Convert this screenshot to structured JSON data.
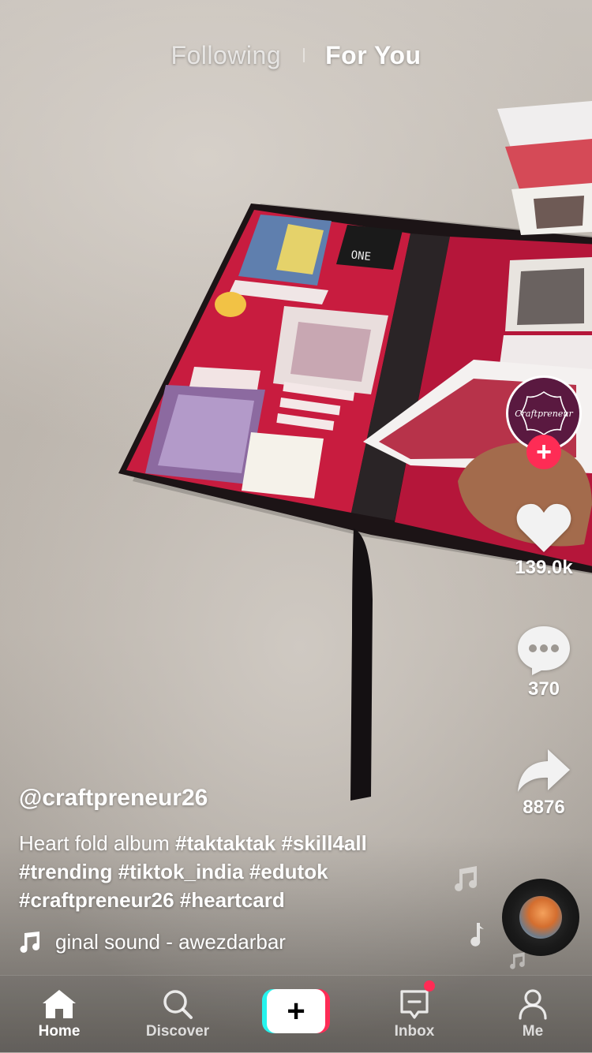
{
  "header": {
    "tabs": [
      {
        "label": "Following"
      },
      {
        "label": "For You"
      }
    ],
    "active_tab": "For You"
  },
  "creator": {
    "avatar_text": "Craftpreneur"
  },
  "actions": {
    "likes": {
      "icon": "heart-icon",
      "count": "139.0k"
    },
    "comments": {
      "icon": "comment-icon",
      "count": "370"
    },
    "shares": {
      "icon": "share-icon",
      "count": "8876"
    }
  },
  "video": {
    "username": "@craftpreneur26",
    "caption_text": "Heart fold album ",
    "hashtags_line1": [
      "#taktaktak",
      "#skill4all"
    ],
    "hashtags_line2": [
      "#trending",
      "#tiktok_india",
      "#edutok"
    ],
    "hashtags_line3": [
      "#craftpreneur26",
      "#heartcard"
    ],
    "sound": "ginal sound - awezdarbar"
  },
  "nav": {
    "items": [
      {
        "label": "Home",
        "icon": "home-icon"
      },
      {
        "label": "Discover",
        "icon": "search-icon"
      },
      {
        "label": "",
        "icon": "plus-icon"
      },
      {
        "label": "Inbox",
        "icon": "inbox-icon"
      },
      {
        "label": "Me",
        "icon": "profile-icon"
      }
    ]
  },
  "colors": {
    "accent_red": "#fe2c55",
    "accent_cyan": "#25f4ee",
    "avatar_purple": "#5a1940",
    "album_red": "#c81c3f"
  }
}
